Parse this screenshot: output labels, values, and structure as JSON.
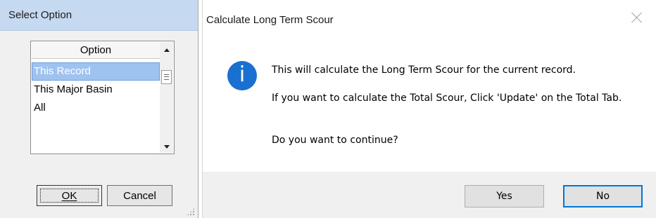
{
  "select_dialog": {
    "title": "Select Option",
    "list_header": "Option",
    "items": [
      {
        "label": "This Record",
        "selected": true
      },
      {
        "label": "This Major Basin",
        "selected": false
      },
      {
        "label": "All",
        "selected": false
      }
    ],
    "ok_label": "OK",
    "cancel_label": "Cancel"
  },
  "scour_dialog": {
    "title": "Calculate Long Term Scour",
    "icon": "info-icon",
    "icon_glyph": "i",
    "message_1": "This will calculate the Long Term Scour for the current record.",
    "message_2": "If you want to calculate the Total Scour, Click 'Update' on the Total Tab.",
    "message_3": "Do you want to continue?",
    "yes_label": "Yes",
    "no_label": "No"
  },
  "colors": {
    "select_titlebar": "#c5d9f1",
    "selection": "#9fc3f0",
    "info_icon": "#1a70d0",
    "default_button_border": "#0078d7"
  }
}
